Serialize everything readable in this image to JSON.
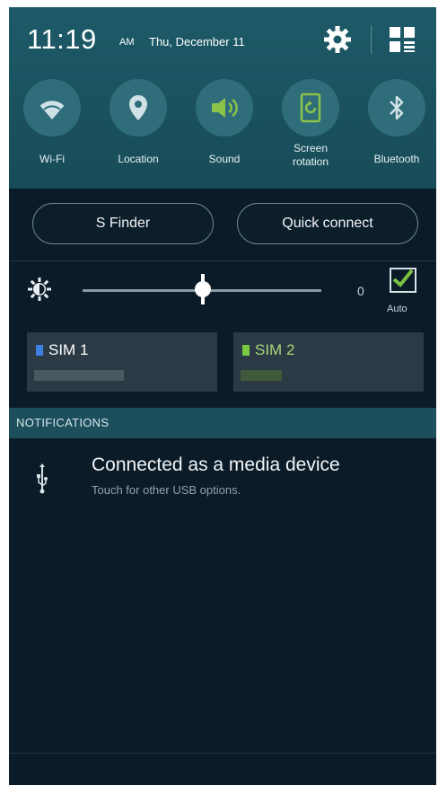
{
  "status": {
    "time": "11:19",
    "ampm": "AM",
    "date": "Thu, December 11",
    "settings_icon": "gear-icon",
    "quick_panel_icon": "grid-edit-icon"
  },
  "toggles": [
    {
      "label": "Wi-Fi",
      "icon": "wifi-icon",
      "active": false
    },
    {
      "label": "Location",
      "icon": "location-pin-icon",
      "active": false
    },
    {
      "label": "Sound",
      "icon": "speaker-icon",
      "active": true
    },
    {
      "label_line1": "Screen",
      "label_line2": "rotation",
      "icon": "rotation-icon",
      "active": true
    },
    {
      "label": "Bluetooth",
      "icon": "bluetooth-icon",
      "active": false
    }
  ],
  "buttons": {
    "s_finder": "S Finder",
    "quick_connect": "Quick connect"
  },
  "brightness": {
    "value": "0",
    "auto_label": "Auto",
    "auto_checked": true,
    "level": 0.5
  },
  "sims": [
    {
      "label": "SIM 1",
      "color": "#3b7fe0"
    },
    {
      "label": "SIM 2",
      "color": "#7ac943"
    }
  ],
  "notifications": {
    "header": "NOTIFICATIONS",
    "items": [
      {
        "title": "Connected as a media device",
        "subtitle": "Touch for other USB options.",
        "icon": "usb-icon"
      }
    ]
  },
  "colors": {
    "accent_active": "#8bc34a",
    "panel_bg": "#1d5a68",
    "body_bg": "#0b1b28"
  }
}
